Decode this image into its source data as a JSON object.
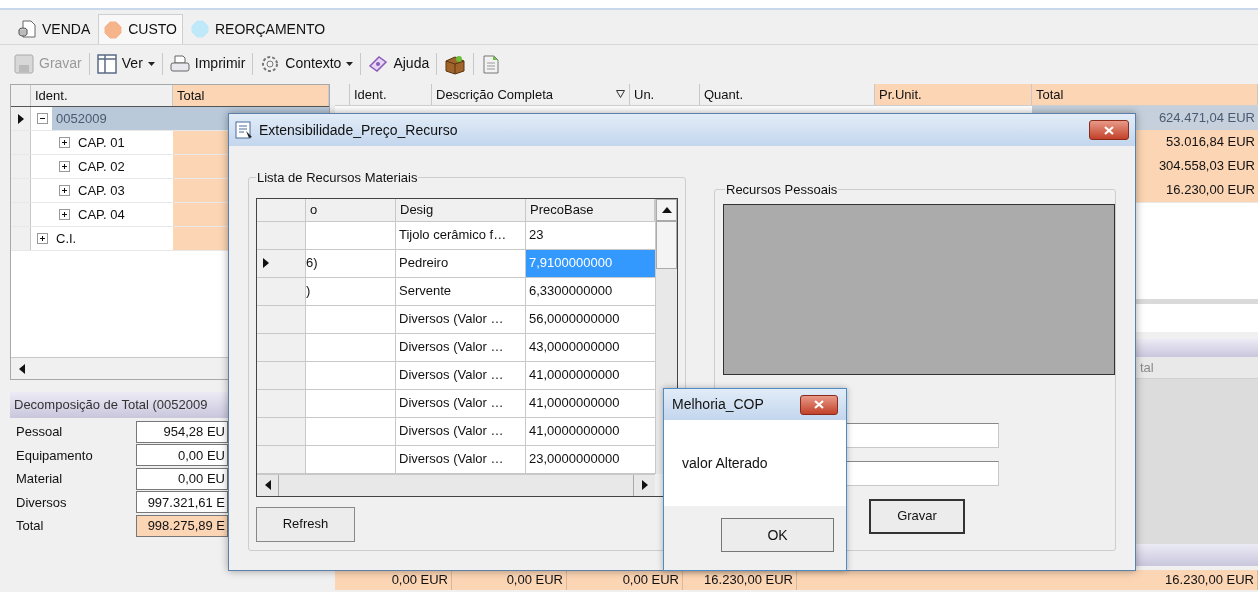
{
  "tabs": [
    {
      "label": "VENDA",
      "kind": "document",
      "selected": false
    },
    {
      "label": "CUSTO",
      "kind": "octagon",
      "color": "#f5b48a",
      "selected": true
    },
    {
      "label": "REORÇAMENTO",
      "kind": "octagon",
      "color": "#bfe8f8",
      "selected": false
    }
  ],
  "toolbar": [
    {
      "kind": "save",
      "label": "Gravar",
      "disabled": true,
      "dropdown": false
    },
    {
      "kind": "view",
      "label": "Ver",
      "disabled": false,
      "dropdown": true
    },
    {
      "kind": "print",
      "label": "Imprimir",
      "disabled": false,
      "dropdown": false
    },
    {
      "kind": "context",
      "label": "Contexto",
      "disabled": false,
      "dropdown": true
    },
    {
      "kind": "help",
      "label": "Ajuda",
      "disabled": false,
      "dropdown": false
    },
    {
      "kind": "crate"
    },
    {
      "kind": "database"
    }
  ],
  "tree": {
    "columns": [
      "Ident.",
      "Total"
    ],
    "rows": [
      {
        "label": "0052009",
        "selected": true,
        "expanded": true,
        "children": [
          {
            "label": "CAP. 01",
            "selected": false,
            "expanded": false
          },
          {
            "label": "CAP. 02",
            "selected": false,
            "expanded": false
          },
          {
            "label": "CAP. 03",
            "selected": false,
            "expanded": false
          },
          {
            "label": "CAP. 04",
            "selected": false,
            "expanded": false
          }
        ]
      },
      {
        "label": "C.I.",
        "selected": false,
        "expanded": false
      }
    ]
  },
  "decomposition": {
    "title": "Decomposição de Total (0052009",
    "rows": [
      {
        "label": "Pessoal",
        "value": "954,28 EU",
        "highlight": false
      },
      {
        "label": "Equipamento",
        "value": "0,00 EU",
        "highlight": false
      },
      {
        "label": "Material",
        "value": "0,00 EU",
        "highlight": false
      },
      {
        "label": "Diversos",
        "value": "997.321,61 E",
        "highlight": false
      },
      {
        "label": "Total",
        "value": "998.275,89 E",
        "highlight": true
      }
    ]
  },
  "grid": {
    "columns": [
      {
        "label": "Ident.",
        "highlighted": false,
        "filter": false
      },
      {
        "label": "Descrição Completa",
        "highlighted": false,
        "filter": true
      },
      {
        "label": "Un.",
        "highlighted": false,
        "filter": false
      },
      {
        "label": "Quant.",
        "highlighted": false,
        "filter": false
      },
      {
        "label": "Pr.Unit.",
        "highlighted": true,
        "filter": false
      },
      {
        "label": "Total",
        "highlighted": true,
        "filter": false
      }
    ],
    "rows": [
      {
        "total": "624.471,04 EUR",
        "selected": true
      },
      {
        "total": "53.016,84 EUR",
        "selected": false
      },
      {
        "total": "304.558,03 EUR",
        "selected": false
      },
      {
        "total": "16.230,00 EUR",
        "selected": false
      }
    ],
    "footer": [
      "0,00 EUR",
      "0,00 EUR",
      "0,00 EUR",
      "16.230,00 EUR",
      "16.230,00 EUR"
    ]
  },
  "detail_grid": {
    "columns": [
      "tal"
    ]
  },
  "dialog": {
    "title": "Extensibilidade_Preço_Recurso",
    "materials": {
      "title": "Lista de Recursos Materiais",
      "columns": [
        "o",
        "Desig",
        "PrecoBase"
      ],
      "rows": [
        {
          "desig": "Tijolo cerâmico f…",
          "price": "23",
          "selected": false
        },
        {
          "code": "6)",
          "desig": "Pedreiro",
          "price": "7,9100000000",
          "selected": true
        },
        {
          "code": ")",
          "desig": "Servente",
          "price": "6,3300000000",
          "selected": false
        },
        {
          "desig": "Diversos (Valor …",
          "price": "56,0000000000",
          "selected": false
        },
        {
          "desig": "Diversos (Valor …",
          "price": "43,0000000000",
          "selected": false
        },
        {
          "desig": "Diversos (Valor …",
          "price": "41,0000000000",
          "selected": false
        },
        {
          "desig": "Diversos (Valor …",
          "price": "41,0000000000",
          "selected": false
        },
        {
          "desig": "Diversos (Valor …",
          "price": "41,0000000000",
          "selected": false
        },
        {
          "desig": "Diversos (Valor …",
          "price": "23,0000000000",
          "selected": false
        }
      ]
    },
    "refresh": "Refresh",
    "personnel": {
      "title": "Recursos Pessoais"
    },
    "save": "Gravar"
  },
  "message": {
    "title": "Melhoria_COP",
    "text": "valor Alterado",
    "button": "OK"
  }
}
